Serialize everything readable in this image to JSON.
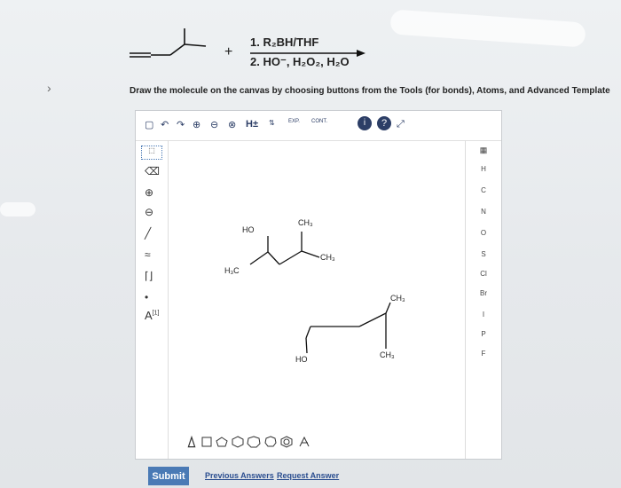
{
  "reaction": {
    "plus": "+",
    "reagent_step1": "1. R₂BH/THF",
    "reagent_step2": "2. HO⁻, H₂O₂, H₂O"
  },
  "instructions": "Draw the molecule on the canvas by choosing buttons from the Tools (for bonds), Atoms, and Advanced Template",
  "toolbar": {
    "h_label": "H±",
    "exp_label": "EXP.",
    "cont_label": "CONT."
  },
  "left_tools": {
    "charge_label": "A",
    "charge_sup": "[1]"
  },
  "atoms": [
    "H",
    "C",
    "N",
    "O",
    "S",
    "Cl",
    "Br",
    "I",
    "P",
    "F"
  ],
  "molecule1": {
    "ho": "HO",
    "ch3_top": "CH₃",
    "ch3_right": "CH₃",
    "h3c": "H₃C"
  },
  "molecule2": {
    "ho": "HO",
    "ch3_top": "CH₃",
    "ch3_bottom": "CH₃"
  },
  "actions": {
    "submit": "Submit",
    "previous_answers": "Previous Answers",
    "request_answer": "Request Answer"
  }
}
